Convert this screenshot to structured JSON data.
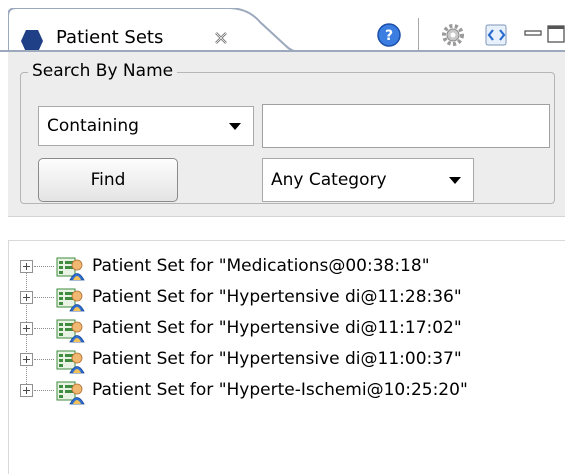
{
  "tab": {
    "title": "Patient Sets",
    "close_icon": "close-icon",
    "icon": "patient-sets-icon"
  },
  "toolbar": {
    "help_icon": "help-icon",
    "settings_icon": "gear-icon",
    "sync_icon": "sync-icon",
    "minimize_icon": "minimize-icon",
    "maximize_icon": "maximize-icon"
  },
  "search": {
    "group_label": "Search By Name",
    "match_mode": "Containing",
    "query_value": "",
    "find_label": "Find",
    "category": "Any Category"
  },
  "tree": {
    "items": [
      {
        "label": "Patient Set for \"Medications@00:38:18\""
      },
      {
        "label": "Patient Set for \"Hypertensive di@11:28:36\""
      },
      {
        "label": "Patient Set for \"Hypertensive di@11:17:02\""
      },
      {
        "label": "Patient Set for \"Hypertensive di@11:00:37\""
      },
      {
        "label": "Patient Set for \"Hyperte-Ischemi@10:25:20\""
      }
    ]
  },
  "colors": {
    "tab_icon": "#1f3f86",
    "tab_border": "#9ca9bd",
    "panel_bg": "#ededed"
  }
}
